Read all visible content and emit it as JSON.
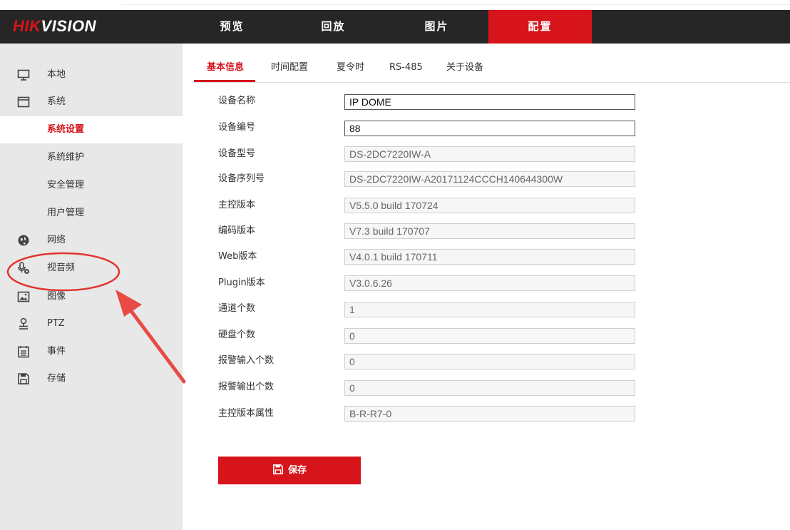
{
  "brand": {
    "prefix": "HIK",
    "suffix": "VISION"
  },
  "nav": [
    {
      "label": "预览"
    },
    {
      "label": "回放"
    },
    {
      "label": "图片"
    },
    {
      "label": "配置"
    }
  ],
  "active_nav": "配置",
  "sidebar": {
    "items": [
      {
        "label": "本地",
        "icon": "monitor-icon"
      },
      {
        "label": "系统",
        "icon": "window-icon"
      },
      {
        "label": "系统设置",
        "sub": true,
        "active": true
      },
      {
        "label": "系统维护",
        "sub": true
      },
      {
        "label": "安全管理",
        "sub": true
      },
      {
        "label": "用户管理",
        "sub": true
      },
      {
        "label": "网络",
        "icon": "globe-icon"
      },
      {
        "label": "视音频",
        "icon": "mic-icon"
      },
      {
        "label": "图像",
        "icon": "image-icon"
      },
      {
        "label": "PTZ",
        "icon": "ptz-icon"
      },
      {
        "label": "事件",
        "icon": "calendar-icon"
      },
      {
        "label": "存储",
        "icon": "floppy-icon"
      }
    ]
  },
  "tabs": [
    {
      "label": "基本信息",
      "active": true
    },
    {
      "label": "时间配置"
    },
    {
      "label": "夏令时"
    },
    {
      "label": "RS-485"
    },
    {
      "label": "关于设备"
    }
  ],
  "form": {
    "rows": [
      {
        "label": "设备名称",
        "value": "IP DOME",
        "editable": true
      },
      {
        "label": "设备编号",
        "value": "88",
        "editable": true
      },
      {
        "label": "设备型号",
        "value": "DS-2DC7220IW-A"
      },
      {
        "label": "设备序列号",
        "value": "DS-2DC7220IW-A20171124CCCH140644300W"
      },
      {
        "label": "主控版本",
        "value": "V5.5.0 build 170724"
      },
      {
        "label": "编码版本",
        "value": "V7.3 build 170707"
      },
      {
        "label": "Web版本",
        "value": "V4.0.1 build 170711"
      },
      {
        "label": "Plugin版本",
        "value": "V3.0.6.26"
      },
      {
        "label": "通道个数",
        "value": "1"
      },
      {
        "label": "硬盘个数",
        "value": "0"
      },
      {
        "label": "报警输入个数",
        "value": "0"
      },
      {
        "label": "报警输出个数",
        "value": "0"
      },
      {
        "label": "主控版本属性",
        "value": "B-R-R7-0"
      }
    ]
  },
  "save_label": "保存",
  "colors": {
    "accent": "#d7141a",
    "header_bg": "#262626",
    "sidebar_bg": "#e8e8e8"
  }
}
